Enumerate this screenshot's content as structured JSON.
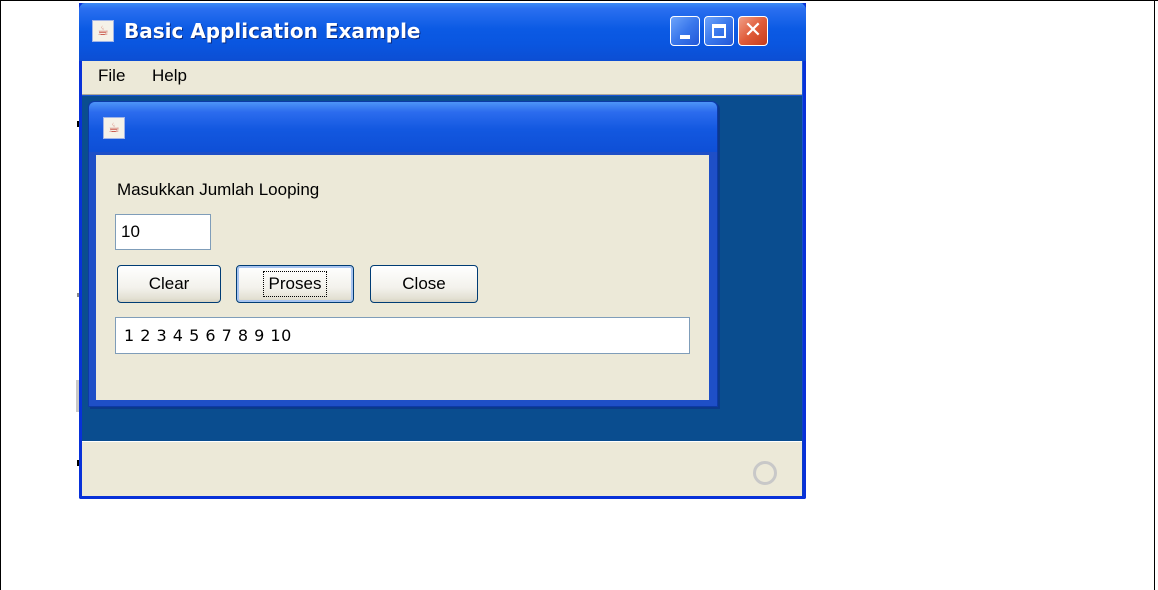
{
  "outer_window": {
    "title": "Basic Application Example",
    "icon": "java-cup-icon",
    "controls": {
      "minimize": "minimize-icon",
      "maximize": "maximize-icon",
      "close": "close-icon"
    }
  },
  "menubar": {
    "items": [
      {
        "label": "File"
      },
      {
        "label": "Help"
      }
    ]
  },
  "internal_frame": {
    "icon": "java-cup-icon",
    "form": {
      "loop_label": "Masukkan Jumlah Looping",
      "loop_count_value": "10",
      "buttons": {
        "clear": "Clear",
        "process": "Proses",
        "close": "Close"
      },
      "focused_button": "process",
      "output_value": "1 2 3 4 5 6 7 8 9 10"
    }
  },
  "statusbar": {
    "busy_indicator": "busy-idle-icon"
  },
  "colors": {
    "titlebar_blue": "#0b5ae4",
    "desktop_blue": "#0a4d8f",
    "panel_beige": "#ece9d8",
    "close_red": "#e05c3a"
  }
}
